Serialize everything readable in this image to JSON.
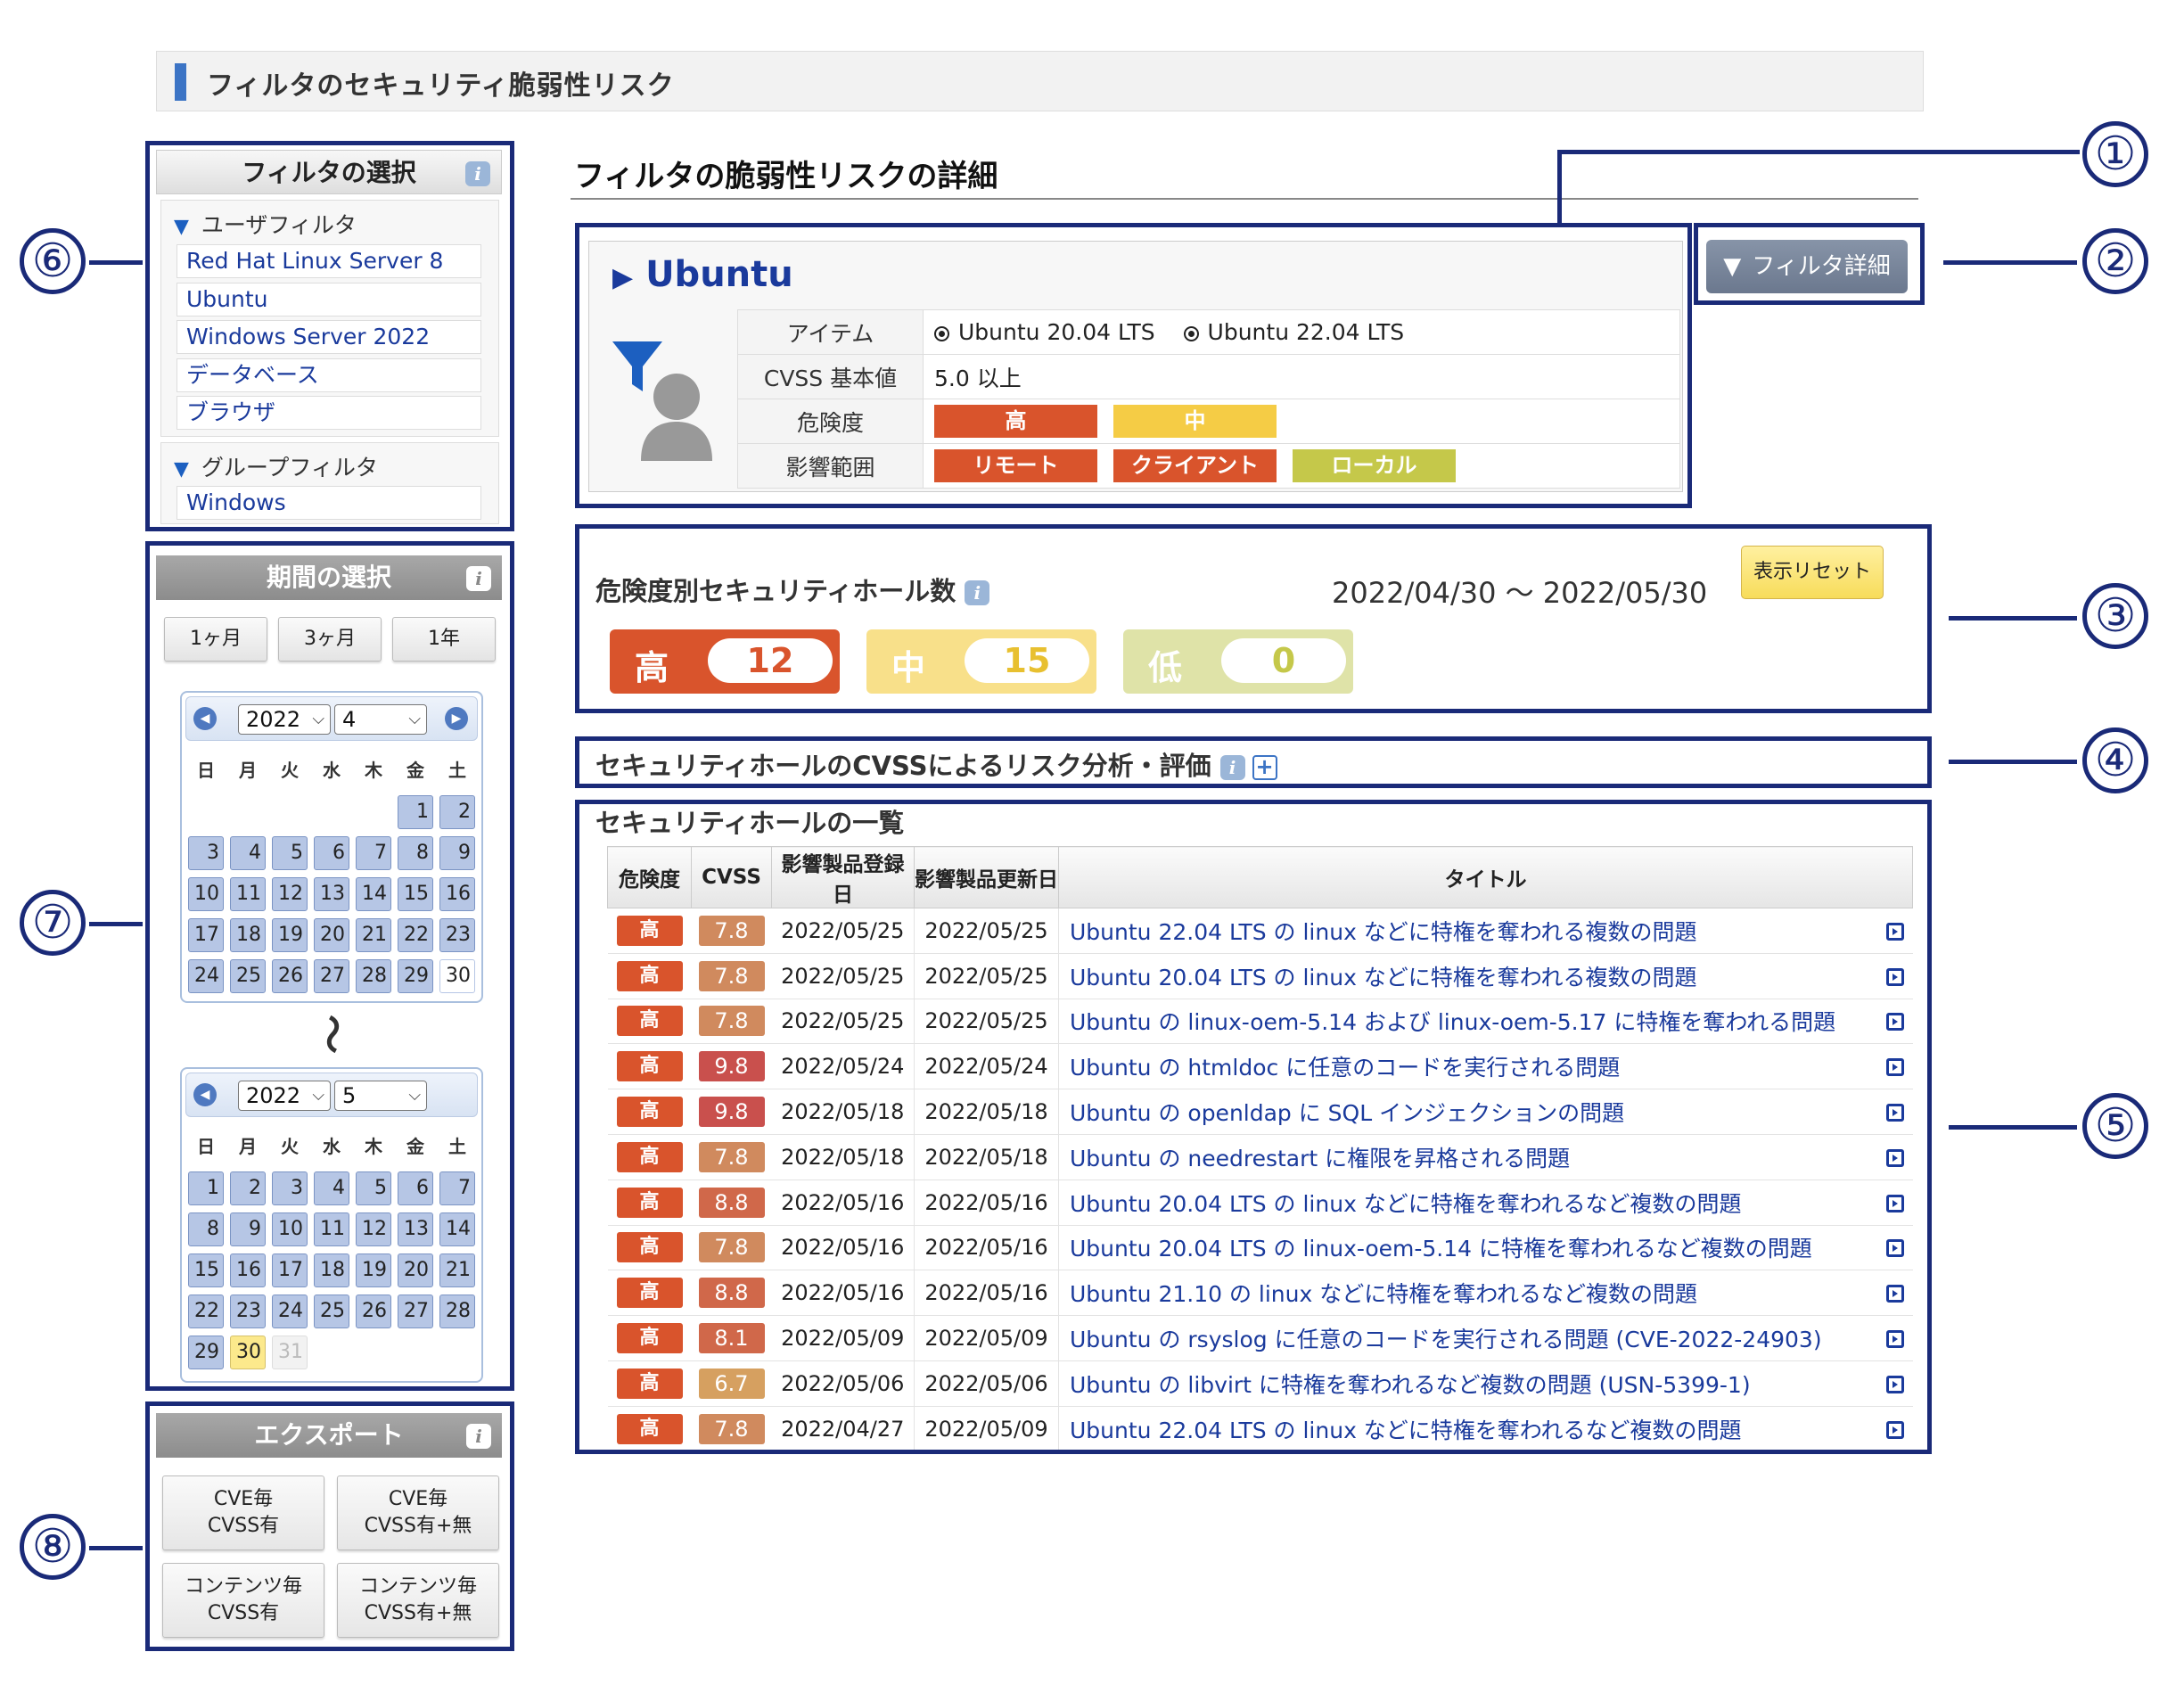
{
  "header": {
    "title": "フィルタのセキュリティ脆弱性リスク"
  },
  "filter_panel": {
    "title": "フィルタの選択",
    "user_group_label": "ユーザフィルタ",
    "user_filters": [
      "Red Hat Linux Server 8",
      "Ubuntu",
      "Windows Server 2022",
      "データベース",
      "ブラウザ"
    ],
    "group_group_label": "グループフィルタ",
    "group_filters": [
      "Windows"
    ]
  },
  "period_panel": {
    "title": "期間の選択",
    "quick_buttons": [
      "1ヶ月",
      "3ヶ月",
      "1年"
    ],
    "weekdays": [
      "日",
      "月",
      "火",
      "水",
      "木",
      "金",
      "土"
    ],
    "range_separator": "〜",
    "calendar_from": {
      "year": "2022",
      "month": "4",
      "days": [
        [
          "",
          "",
          "",
          "",
          "",
          "1",
          "2"
        ],
        [
          "3",
          "4",
          "5",
          "6",
          "7",
          "8",
          "9"
        ],
        [
          "10",
          "11",
          "12",
          "13",
          "14",
          "15",
          "16"
        ],
        [
          "17",
          "18",
          "19",
          "20",
          "21",
          "22",
          "23"
        ],
        [
          "24",
          "25",
          "26",
          "27",
          "28",
          "29",
          "30"
        ]
      ],
      "today": "30"
    },
    "calendar_to": {
      "year": "2022",
      "month": "5",
      "days": [
        [
          "1",
          "2",
          "3",
          "4",
          "5",
          "6",
          "7"
        ],
        [
          "8",
          "9",
          "10",
          "11",
          "12",
          "13",
          "14"
        ],
        [
          "15",
          "16",
          "17",
          "18",
          "19",
          "20",
          "21"
        ],
        [
          "22",
          "23",
          "24",
          "25",
          "26",
          "27",
          "28"
        ],
        [
          "29",
          "30",
          "31",
          "",
          "",
          "",
          ""
        ]
      ],
      "selected": "30",
      "disabled": [
        "31"
      ]
    }
  },
  "export_panel": {
    "title": "エクスポート",
    "buttons": [
      {
        "line1": "CVE毎",
        "line2": "CVSS有"
      },
      {
        "line1": "CVE毎",
        "line2": "CVSS有+無"
      },
      {
        "line1": "コンテンツ毎",
        "line2": "CVSS有"
      },
      {
        "line1": "コンテンツ毎",
        "line2": "CVSS有+無"
      }
    ]
  },
  "main": {
    "title": "フィルタの脆弱性リスクの詳細",
    "filter_detail_button": "フィルタ詳細",
    "filter_card": {
      "name": "Ubuntu",
      "rows": [
        {
          "label": "アイテム",
          "items": [
            "Ubuntu 20.04 LTS",
            "Ubuntu 22.04 LTS"
          ]
        },
        {
          "label": "CVSS 基本値",
          "value": "5.0 以上"
        },
        {
          "label": "危険度",
          "chips": [
            {
              "text": "高",
              "color": "#d9542c"
            },
            {
              "text": "中",
              "color": "#f5cc45"
            }
          ]
        },
        {
          "label": "影響範囲",
          "chips": [
            {
              "text": "リモート",
              "color": "#d9542c"
            },
            {
              "text": "クライアント",
              "color": "#d9542c"
            },
            {
              "text": "ローカル",
              "color": "#c5c84a"
            }
          ]
        }
      ]
    },
    "severity_counts": {
      "title": "危険度別セキュリティホール数",
      "date_range": "2022/04/30 〜 2022/05/30",
      "reset_button": "表示リセット",
      "items": [
        {
          "label": "高",
          "value": "12",
          "bg": "#d9542c",
          "text": "#d9542c"
        },
        {
          "label": "中",
          "value": "15",
          "bg": "#f8e08a",
          "text": "#e8c030"
        },
        {
          "label": "低",
          "value": "0",
          "bg": "#dfe3a8",
          "text": "#c5c84a"
        }
      ]
    },
    "cvss_section": {
      "title": "セキュリティホールのCVSSによるリスク分析・評価"
    },
    "list_section": {
      "title": "セキュリティホールの一覧",
      "columns": [
        "危険度",
        "CVSS",
        "影響製品登録日",
        "影響製品更新日",
        "タイトル"
      ],
      "rows": [
        {
          "sev": "高",
          "cvss": "7.8",
          "reg": "2022/05/25",
          "upd": "2022/05/25",
          "title": "Ubuntu 22.04 LTS の linux などに特権を奪われる複数の問題"
        },
        {
          "sev": "高",
          "cvss": "7.8",
          "reg": "2022/05/25",
          "upd": "2022/05/25",
          "title": "Ubuntu 20.04 LTS の linux などに特権を奪われる複数の問題"
        },
        {
          "sev": "高",
          "cvss": "7.8",
          "reg": "2022/05/25",
          "upd": "2022/05/25",
          "title": "Ubuntu の linux-oem-5.14 および linux-oem-5.17 に特権を奪われる問題"
        },
        {
          "sev": "高",
          "cvss": "9.8",
          "reg": "2022/05/24",
          "upd": "2022/05/24",
          "title": "Ubuntu の htmldoc に任意のコードを実行される問題"
        },
        {
          "sev": "高",
          "cvss": "9.8",
          "reg": "2022/05/18",
          "upd": "2022/05/18",
          "title": "Ubuntu の openldap に SQL インジェクションの問題"
        },
        {
          "sev": "高",
          "cvss": "7.8",
          "reg": "2022/05/18",
          "upd": "2022/05/18",
          "title": "Ubuntu の needrestart に権限を昇格される問題"
        },
        {
          "sev": "高",
          "cvss": "8.8",
          "reg": "2022/05/16",
          "upd": "2022/05/16",
          "title": "Ubuntu 20.04 LTS の linux などに特権を奪われるなど複数の問題"
        },
        {
          "sev": "高",
          "cvss": "7.8",
          "reg": "2022/05/16",
          "upd": "2022/05/16",
          "title": "Ubuntu 20.04 LTS の linux-oem-5.14 に特権を奪われるなど複数の問題"
        },
        {
          "sev": "高",
          "cvss": "8.8",
          "reg": "2022/05/16",
          "upd": "2022/05/16",
          "title": "Ubuntu 21.10 の linux などに特権を奪われるなど複数の問題"
        },
        {
          "sev": "高",
          "cvss": "8.1",
          "reg": "2022/05/09",
          "upd": "2022/05/09",
          "title": "Ubuntu の rsyslog に任意のコードを実行される問題 (CVE-2022-24903)"
        },
        {
          "sev": "高",
          "cvss": "6.7",
          "reg": "2022/05/06",
          "upd": "2022/05/06",
          "title": "Ubuntu の libvirt に特権を奪われるなど複数の問題 (USN-5399-1)"
        },
        {
          "sev": "高",
          "cvss": "7.8",
          "reg": "2022/04/27",
          "upd": "2022/05/09",
          "title": "Ubuntu 22.04 LTS の linux などに特権を奪われるなど複数の問題"
        }
      ],
      "cvss_colors": {
        "9.8": "#c9504d",
        "8.8": "#d0684a",
        "8.1": "#d0684a",
        "7.8": "#d08a5e",
        "6.7": "#d6a060"
      }
    }
  },
  "annotations": [
    "①",
    "②",
    "③",
    "④",
    "⑤",
    "⑥",
    "⑦",
    "⑧"
  ]
}
